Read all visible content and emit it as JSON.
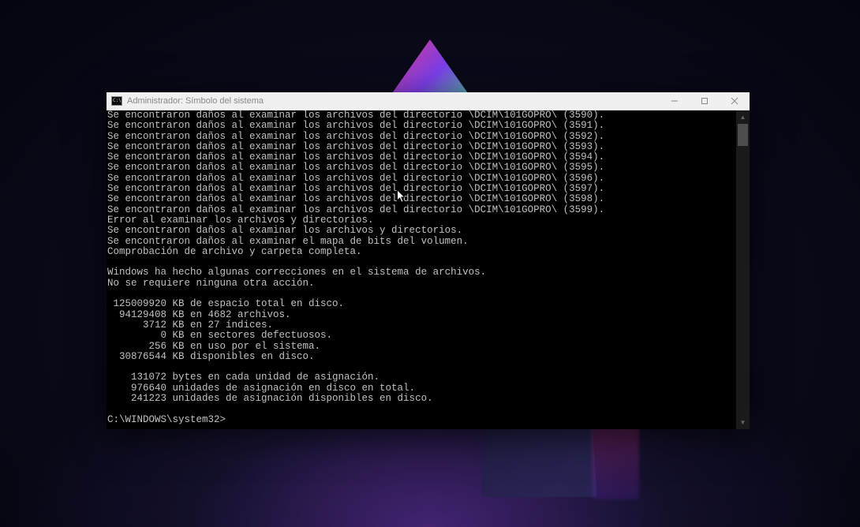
{
  "window": {
    "title": "Administrador: Símbolo del sistema",
    "icon_label": "cmd-icon"
  },
  "terminal": {
    "output_lines": [
      "Se encontraron daños al examinar los archivos del directorio \\DCIM\\101GOPRO\\ (3590).",
      "Se encontraron daños al examinar los archivos del directorio \\DCIM\\101GOPRO\\ (3591).",
      "Se encontraron daños al examinar los archivos del directorio \\DCIM\\101GOPRO\\ (3592).",
      "Se encontraron daños al examinar los archivos del directorio \\DCIM\\101GOPRO\\ (3593).",
      "Se encontraron daños al examinar los archivos del directorio \\DCIM\\101GOPRO\\ (3594).",
      "Se encontraron daños al examinar los archivos del directorio \\DCIM\\101GOPRO\\ (3595).",
      "Se encontraron daños al examinar los archivos del directorio \\DCIM\\101GOPRO\\ (3596).",
      "Se encontraron daños al examinar los archivos del directorio \\DCIM\\101GOPRO\\ (3597).",
      "Se encontraron daños al examinar los archivos del directorio \\DCIM\\101GOPRO\\ (3598).",
      "Se encontraron daños al examinar los archivos del directorio \\DCIM\\101GOPRO\\ (3599).",
      "Error al examinar los archivos y directorios.",
      "Se encontraron daños al examinar los archivos y directorios.",
      "Se encontraron daños al examinar el mapa de bits del volumen.",
      "Comprobación de archivo y carpeta completa.",
      "",
      "Windows ha hecho algunas correcciones en el sistema de archivos.",
      "No se requiere ninguna otra acción.",
      "",
      " 125009920 KB de espacio total en disco.",
      "  94129408 KB en 4682 archivos.",
      "      3712 KB en 27 índices.",
      "         0 KB en sectores defectuosos.",
      "       256 KB en uso por el sistema.",
      "  30876544 KB disponibles en disco.",
      "",
      "    131072 bytes en cada unidad de asignación.",
      "    976640 unidades de asignación en disco en total.",
      "    241223 unidades de asignación disponibles en disco.",
      ""
    ],
    "prompt": "C:\\WINDOWS\\system32>"
  }
}
